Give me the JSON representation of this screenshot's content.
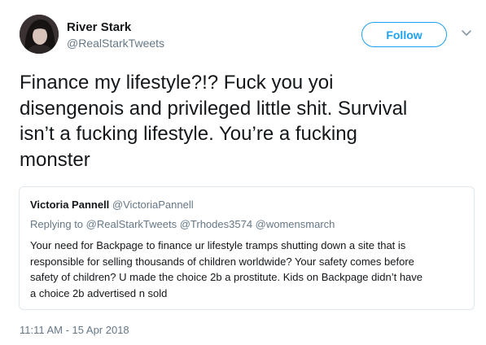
{
  "author": {
    "name": "River Stark",
    "handle": "@RealStarkTweets",
    "avatar_icon": "profile-photo"
  },
  "actions": {
    "follow_label": "Follow",
    "menu_icon": "chevron-down-icon"
  },
  "tweet": {
    "lines": [
      "Finance my lifestyle?!? Fuck you yoi",
      "disengenois and privileged little shit. Survival",
      "isn’t a fucking lifestyle. You’re a fucking",
      "monster"
    ],
    "timestamp": "11:11 AM - 15 Apr 2018"
  },
  "quoted_tweet": {
    "name": "Victoria Pannell",
    "handle": "@VictoriaPannell",
    "replying_to": "Replying to @RealStarkTweets @Trhodes3574 @womensmarch",
    "lines": [
      "Your need for Backpage to finance ur lifestyle tramps shutting down a site that is",
      "responsible for selling thousands of children worldwide? Your safety comes before",
      "safety of children? U made the choice 2b a prostitute. Kids on Backpage didn’t have",
      "a choice 2b advertised n sold"
    ]
  },
  "colors": {
    "accent": "#1da1f2",
    "text": "#14171a",
    "muted": "#657786",
    "border": "#e1e8ed"
  }
}
